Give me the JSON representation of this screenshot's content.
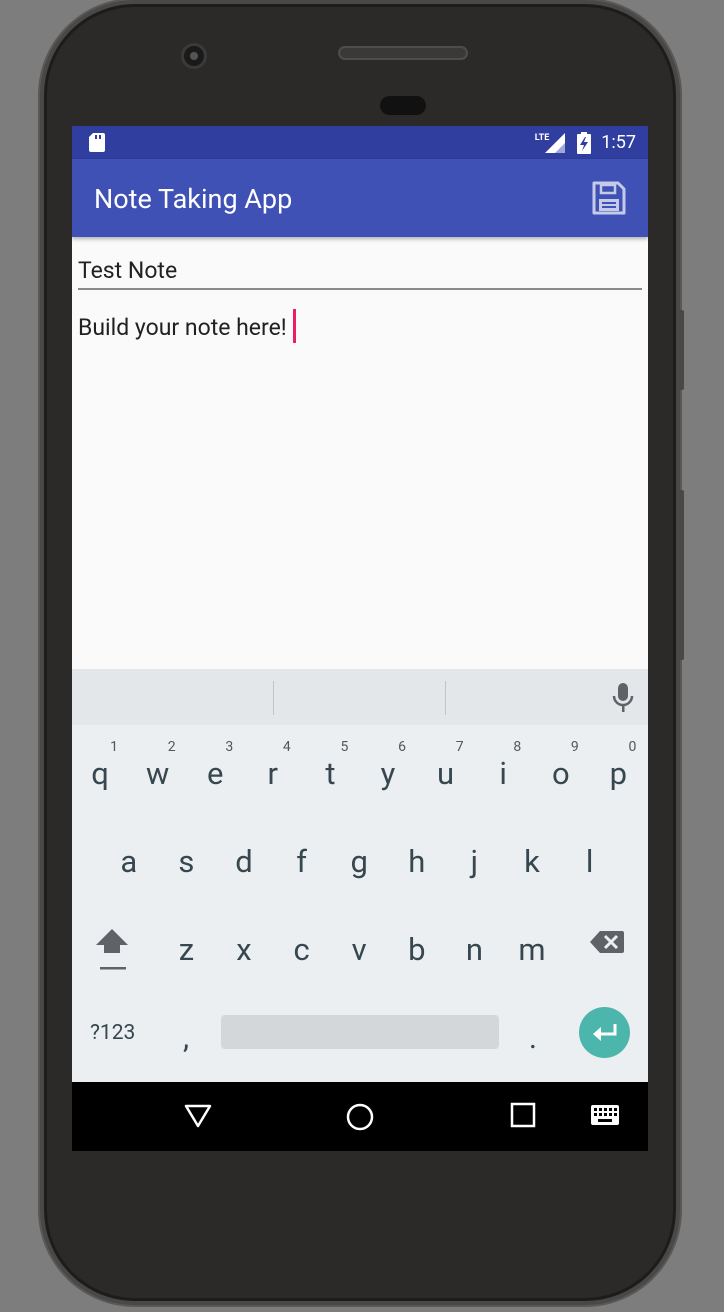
{
  "status_bar": {
    "network": "LTE",
    "time": "1:57"
  },
  "app_bar": {
    "title": "Note Taking App",
    "save_icon": "save-icon"
  },
  "note": {
    "title": "Test Note",
    "body": "Build your note here!"
  },
  "keyboard": {
    "row1": [
      {
        "c": "q",
        "h": "1"
      },
      {
        "c": "w",
        "h": "2"
      },
      {
        "c": "e",
        "h": "3"
      },
      {
        "c": "r",
        "h": "4"
      },
      {
        "c": "t",
        "h": "5"
      },
      {
        "c": "y",
        "h": "6"
      },
      {
        "c": "u",
        "h": "7"
      },
      {
        "c": "i",
        "h": "8"
      },
      {
        "c": "o",
        "h": "9"
      },
      {
        "c": "p",
        "h": "0"
      }
    ],
    "row2": [
      "a",
      "s",
      "d",
      "f",
      "g",
      "h",
      "j",
      "k",
      "l"
    ],
    "row3": [
      "z",
      "x",
      "c",
      "v",
      "b",
      "n",
      "m"
    ],
    "sym_label": "?123",
    "comma": ",",
    "period": "."
  },
  "colors": {
    "status_bar": "#303f9f",
    "app_bar": "#3f51b5",
    "cursor": "#e91e63",
    "enter_key": "#4db6ac"
  }
}
